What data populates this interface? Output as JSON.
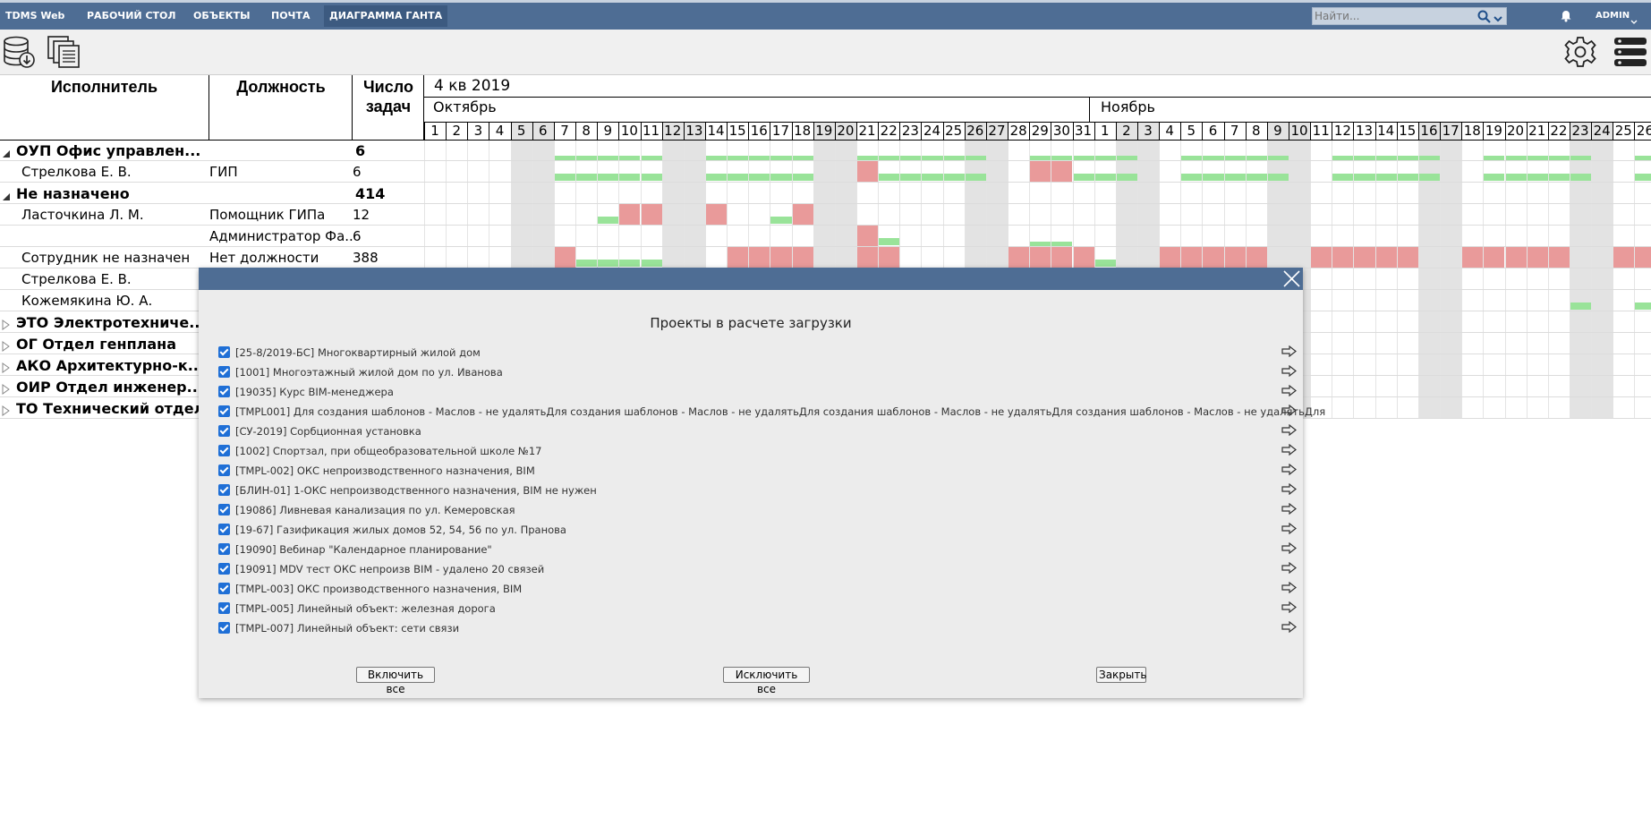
{
  "nav": {
    "brand": "TDMS Web",
    "items": [
      "РАБОЧИЙ СТОЛ",
      "ОБЪЕКТЫ",
      "ПОЧТА",
      "ДИАГРАММА ГАНТА"
    ],
    "active_index": 3,
    "search_placeholder": "Найти...",
    "user": "ADMIN"
  },
  "toolbar": {
    "left_icons": [
      "database-download-icon",
      "copy-documents-icon"
    ],
    "right_icons": [
      "gear-icon",
      "server-list-icon"
    ]
  },
  "grid": {
    "headers": {
      "executor": "Исполнитель",
      "position": "Должность",
      "task_count_line1": "Число",
      "task_count_line2": "задач"
    },
    "quarter": "4 кв 2019",
    "months": [
      "Октябрь",
      "Ноябрь"
    ],
    "days": [
      "1",
      "2",
      "3",
      "4",
      "5",
      "6",
      "7",
      "8",
      "9",
      "10",
      "11",
      "12",
      "13",
      "14",
      "15",
      "16",
      "17",
      "18",
      "19",
      "20",
      "21",
      "22",
      "23",
      "24",
      "25",
      "26",
      "27",
      "28",
      "29",
      "30",
      "31",
      "1",
      "2",
      "3",
      "4",
      "5",
      "6",
      "7",
      "8",
      "9",
      "10",
      "11",
      "12",
      "13",
      "14",
      "15",
      "16",
      "17",
      "18",
      "19",
      "20",
      "21",
      "22",
      "23",
      "24",
      "25",
      "26"
    ],
    "weekend_day_indexes": [
      4,
      5,
      11,
      12,
      18,
      19,
      25,
      26,
      32,
      33,
      39,
      40,
      46,
      47,
      53,
      54
    ],
    "rows": [
      {
        "name": "ОУП Офис управлен...",
        "position": "",
        "count": "6",
        "group": true,
        "expanded": true
      },
      {
        "name": "Стрелкова Е. В.",
        "position": "ГИП",
        "count": "6",
        "group": false
      },
      {
        "name": "Не назначено",
        "position": "",
        "count": "414",
        "group": true,
        "expanded": true
      },
      {
        "name": "Ласточкина Л. М.",
        "position": "Помощник ГИПа",
        "count": "12",
        "group": false
      },
      {
        "name": "",
        "position": "Администратор Фа...",
        "count": "6",
        "group": false
      },
      {
        "name": "Сотрудник не назначен",
        "position": "Нет должности",
        "count": "388",
        "group": false
      },
      {
        "name": "Стрелкова Е. В.",
        "position": "",
        "count": "",
        "group": false
      },
      {
        "name": "Кожемякина Ю. А.",
        "position": "",
        "count": "",
        "group": false
      },
      {
        "name": "ЭТО Электротехниче...",
        "position": "",
        "count": "",
        "group": true,
        "expanded": false
      },
      {
        "name": "ОГ Отдел генплана",
        "position": "",
        "count": "",
        "group": true,
        "expanded": false
      },
      {
        "name": "АКО Архитектурно-к...",
        "position": "",
        "count": "",
        "group": true,
        "expanded": false
      },
      {
        "name": "ОИР Отдел инженер...",
        "position": "",
        "count": "",
        "group": true,
        "expanded": false
      },
      {
        "name": "ТО Технический отдел",
        "position": "",
        "count": "",
        "group": true,
        "expanded": false
      }
    ],
    "load_bars": [
      {
        "row": 0,
        "days": [
          6,
          7,
          8,
          9,
          10,
          13,
          14,
          15,
          16,
          17,
          20,
          21,
          22,
          23,
          24,
          25,
          28,
          29,
          30,
          31,
          32,
          35,
          36,
          37,
          38,
          39,
          42,
          43,
          44,
          45,
          46,
          49,
          50,
          51,
          52,
          53,
          56
        ],
        "color": "#99e399",
        "level": "thin-top"
      },
      {
        "row": 1,
        "days": [
          6,
          7,
          8,
          9,
          10,
          13,
          14,
          15,
          16,
          17,
          21,
          22,
          23,
          24,
          25,
          30,
          31,
          32,
          35,
          36,
          37,
          38,
          39,
          42,
          43,
          44,
          45,
          46,
          49,
          50,
          51,
          52,
          53,
          56
        ],
        "color": "#99e399",
        "level": "bottom"
      },
      {
        "row": 1,
        "days": [
          20,
          28,
          29
        ],
        "color": "#e99a9a",
        "level": "full"
      },
      {
        "row": 3,
        "days": [
          8,
          16,
          17
        ],
        "color": "#99e399",
        "level": "bottom"
      },
      {
        "row": 3,
        "days": [
          9,
          10,
          13,
          17
        ],
        "color": "#e99a9a",
        "level": "full"
      },
      {
        "row": 4,
        "days": [
          20
        ],
        "color": "#e99a9a",
        "level": "full"
      },
      {
        "row": 4,
        "days": [
          21
        ],
        "color": "#99e399",
        "level": "bottom"
      },
      {
        "row": 4,
        "days": [
          28,
          29
        ],
        "color": "#99e399",
        "level": "thin-top"
      },
      {
        "row": 5,
        "days": [
          6,
          14,
          15,
          16,
          17,
          20,
          21,
          27,
          28,
          29,
          30,
          34,
          35,
          36,
          37,
          38,
          41,
          42,
          43,
          44,
          45,
          48,
          49,
          50,
          51,
          52,
          55,
          56
        ],
        "color": "#e99a9a",
        "level": "full"
      },
      {
        "row": 5,
        "days": [
          7,
          8,
          9,
          10,
          31
        ],
        "color": "#99e399",
        "level": "bottom"
      },
      {
        "row": 7,
        "days": [
          53,
          56
        ],
        "color": "#99e399",
        "level": "bottom"
      }
    ]
  },
  "modal": {
    "title": "Проекты в расчете загрузки",
    "projects": [
      {
        "label": "[25-8/2019-БС] Многоквартирный жилой дом",
        "checked": true
      },
      {
        "label": "[1001] Многоэтажный жилой дом по ул. Иванова",
        "checked": true
      },
      {
        "label": "[19035] Курс BIM-менеджера",
        "checked": true
      },
      {
        "label": "[TMPL001] Для создания шаблонов - Маслов - не удалятьДля создания шаблонов - Маслов - не удалятьДля создания шаблонов - Маслов - не удалятьДля создания шаблонов - Маслов - не удалятьДля",
        "checked": true
      },
      {
        "label": "[СУ-2019] Сорбционная установка",
        "checked": true
      },
      {
        "label": "[1002] Спортзал, при общеобразовательной школе №17",
        "checked": true
      },
      {
        "label": "[TMPL-002] ОКС непроизводственного назначения, BIM",
        "checked": true
      },
      {
        "label": "[БЛИН-01] 1-ОКС непроизводственного назначения, BIM не нужен",
        "checked": true
      },
      {
        "label": "[19086] Ливневая канализация по ул. Кемеровская",
        "checked": true
      },
      {
        "label": "[19-67] Газификация жилых домов 52, 54, 56 по ул. Пранова",
        "checked": true
      },
      {
        "label": "[19090] Вебинар \"Календарное планирование\"",
        "checked": true
      },
      {
        "label": "[19091] MDV тест ОКС непроизв BIM - удалено 20 связей",
        "checked": true
      },
      {
        "label": "[TMPL-003] ОКС производственного назначения, BIM",
        "checked": true
      },
      {
        "label": "[TMPL-005] Линейный объект: железная дорога",
        "checked": true
      },
      {
        "label": "[TMPL-007] Линейный объект: сети связи",
        "checked": true
      }
    ],
    "buttons": {
      "include_all": "Включить все",
      "exclude_all": "Исключить все",
      "close": "Закрыть"
    }
  },
  "colors": {
    "nav_bg": "#4e6d94",
    "nav_active": "#3c5a80",
    "weekend": "#e3e3e3",
    "load_ok": "#99e399",
    "load_over": "#e99a9a",
    "checkbox": "#1f6fd6"
  }
}
